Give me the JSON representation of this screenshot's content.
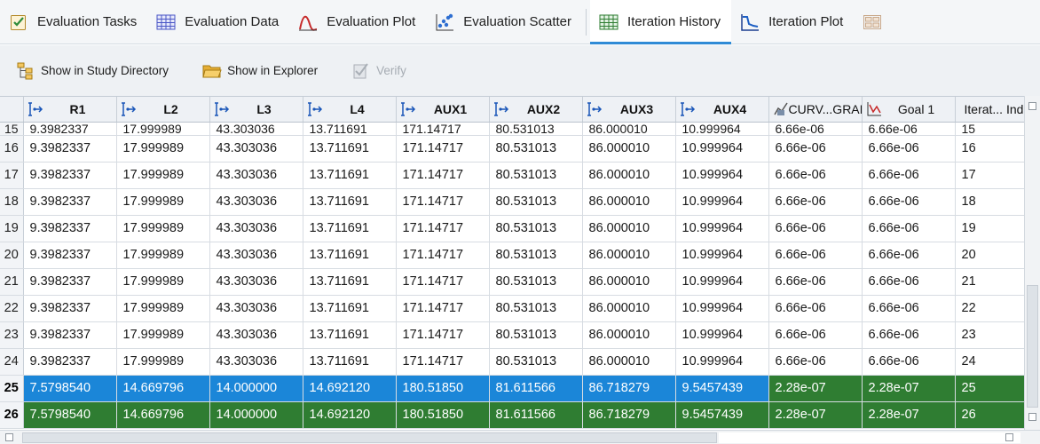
{
  "tabs": [
    {
      "label": "Evaluation Tasks",
      "icon": "checklist-icon"
    },
    {
      "label": "Evaluation Data",
      "icon": "data-table-icon"
    },
    {
      "label": "Evaluation Plot",
      "icon": "curve-plot-icon"
    },
    {
      "label": "Evaluation Scatter",
      "icon": "scatter-plot-icon"
    },
    {
      "label": "Iteration History",
      "icon": "history-table-icon",
      "active": true
    },
    {
      "label": "Iteration Plot",
      "icon": "iteration-plot-icon"
    }
  ],
  "toolbar": {
    "study_dir_label": "Show in Study Directory",
    "explorer_label": "Show in Explorer",
    "verify_label": "Verify"
  },
  "columns": [
    "R1",
    "L2",
    "L3",
    "L4",
    "AUX1",
    "AUX2",
    "AUX3",
    "AUX4",
    "CURV...GRAI",
    "Goal 1",
    "Iterat... Ind"
  ],
  "rows": [
    {
      "n": "15",
      "cells": [
        "9.3982337",
        "17.999989",
        "43.303036",
        "13.711691",
        "171.14717",
        "80.531013",
        "86.000010",
        "10.999964",
        "6.66e-06",
        "6.66e-06",
        "15"
      ]
    },
    {
      "n": "16",
      "cells": [
        "9.3982337",
        "17.999989",
        "43.303036",
        "13.711691",
        "171.14717",
        "80.531013",
        "86.000010",
        "10.999964",
        "6.66e-06",
        "6.66e-06",
        "16"
      ]
    },
    {
      "n": "17",
      "cells": [
        "9.3982337",
        "17.999989",
        "43.303036",
        "13.711691",
        "171.14717",
        "80.531013",
        "86.000010",
        "10.999964",
        "6.66e-06",
        "6.66e-06",
        "17"
      ]
    },
    {
      "n": "18",
      "cells": [
        "9.3982337",
        "17.999989",
        "43.303036",
        "13.711691",
        "171.14717",
        "80.531013",
        "86.000010",
        "10.999964",
        "6.66e-06",
        "6.66e-06",
        "18"
      ]
    },
    {
      "n": "19",
      "cells": [
        "9.3982337",
        "17.999989",
        "43.303036",
        "13.711691",
        "171.14717",
        "80.531013",
        "86.000010",
        "10.999964",
        "6.66e-06",
        "6.66e-06",
        "19"
      ]
    },
    {
      "n": "20",
      "cells": [
        "9.3982337",
        "17.999989",
        "43.303036",
        "13.711691",
        "171.14717",
        "80.531013",
        "86.000010",
        "10.999964",
        "6.66e-06",
        "6.66e-06",
        "20"
      ]
    },
    {
      "n": "21",
      "cells": [
        "9.3982337",
        "17.999989",
        "43.303036",
        "13.711691",
        "171.14717",
        "80.531013",
        "86.000010",
        "10.999964",
        "6.66e-06",
        "6.66e-06",
        "21"
      ]
    },
    {
      "n": "22",
      "cells": [
        "9.3982337",
        "17.999989",
        "43.303036",
        "13.711691",
        "171.14717",
        "80.531013",
        "86.000010",
        "10.999964",
        "6.66e-06",
        "6.66e-06",
        "22"
      ]
    },
    {
      "n": "23",
      "cells": [
        "9.3982337",
        "17.999989",
        "43.303036",
        "13.711691",
        "171.14717",
        "80.531013",
        "86.000010",
        "10.999964",
        "6.66e-06",
        "6.66e-06",
        "23"
      ]
    },
    {
      "n": "24",
      "cells": [
        "9.3982337",
        "17.999989",
        "43.303036",
        "13.711691",
        "171.14717",
        "80.531013",
        "86.000010",
        "10.999964",
        "6.66e-06",
        "6.66e-06",
        "24"
      ]
    },
    {
      "n": "25",
      "cells": [
        "7.5798540",
        "14.669796",
        "14.000000",
        "14.692120",
        "180.51850",
        "81.611566",
        "86.718279",
        "9.5457439",
        "2.28e-07",
        "2.28e-07",
        "25"
      ],
      "selected": "blue"
    },
    {
      "n": "26",
      "cells": [
        "7.5798540",
        "14.669796",
        "14.000000",
        "14.692120",
        "180.51850",
        "81.611566",
        "86.718279",
        "9.5457439",
        "2.28e-07",
        "2.28e-07",
        "26"
      ],
      "selected": "green"
    }
  ],
  "colors": {
    "accent": "#2f8bd6",
    "selection_blue": "#1b86d8",
    "selection_green": "#2f7d32"
  }
}
